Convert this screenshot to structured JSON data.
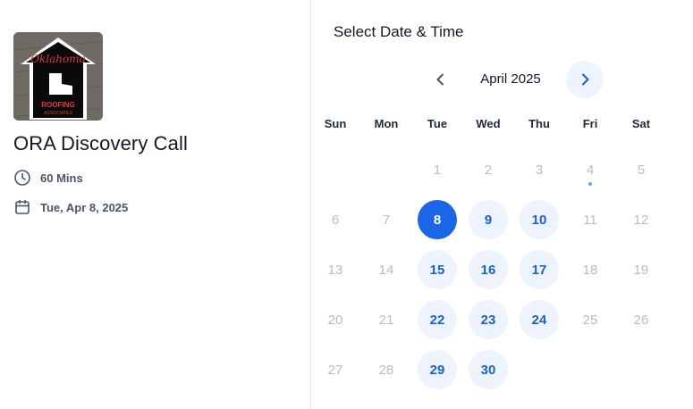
{
  "event": {
    "logo_text": {
      "script": "Oklahoma",
      "company": "ROOFING",
      "company_sub": "ASSOCIATES"
    },
    "title": "ORA Discovery Call",
    "duration": "60 Mins",
    "date": "Tue, Apr 8, 2025",
    "icons": {
      "duration": "clock-icon",
      "date": "calendar-icon"
    }
  },
  "calendar": {
    "heading": "Select Date & Time",
    "month_label": "April 2025",
    "weekdays": [
      "Sun",
      "Mon",
      "Tue",
      "Wed",
      "Thu",
      "Fri",
      "Sat"
    ],
    "start_weekday_index": 2,
    "days": [
      {
        "label": "1",
        "state": "disabled"
      },
      {
        "label": "2",
        "state": "disabled"
      },
      {
        "label": "3",
        "state": "disabled"
      },
      {
        "label": "4",
        "state": "disabled",
        "today": true
      },
      {
        "label": "5",
        "state": "disabled"
      },
      {
        "label": "6",
        "state": "disabled"
      },
      {
        "label": "7",
        "state": "disabled"
      },
      {
        "label": "8",
        "state": "selected"
      },
      {
        "label": "9",
        "state": "available"
      },
      {
        "label": "10",
        "state": "available"
      },
      {
        "label": "11",
        "state": "disabled"
      },
      {
        "label": "12",
        "state": "disabled"
      },
      {
        "label": "13",
        "state": "disabled"
      },
      {
        "label": "14",
        "state": "disabled"
      },
      {
        "label": "15",
        "state": "available"
      },
      {
        "label": "16",
        "state": "available"
      },
      {
        "label": "17",
        "state": "available"
      },
      {
        "label": "18",
        "state": "disabled"
      },
      {
        "label": "19",
        "state": "disabled"
      },
      {
        "label": "20",
        "state": "disabled"
      },
      {
        "label": "21",
        "state": "disabled"
      },
      {
        "label": "22",
        "state": "available"
      },
      {
        "label": "23",
        "state": "available"
      },
      {
        "label": "24",
        "state": "available"
      },
      {
        "label": "25",
        "state": "disabled"
      },
      {
        "label": "26",
        "state": "disabled"
      },
      {
        "label": "27",
        "state": "disabled"
      },
      {
        "label": "28",
        "state": "disabled"
      },
      {
        "label": "29",
        "state": "available"
      },
      {
        "label": "30",
        "state": "available"
      }
    ],
    "icons": {
      "prev": "chevron-left-icon",
      "next": "chevron-right-icon"
    }
  },
  "colors": {
    "accent": "#1a66e6",
    "available_bg": "#eef4fd",
    "available_text": "#1a5fce",
    "disabled_text": "#b8bcc3"
  }
}
